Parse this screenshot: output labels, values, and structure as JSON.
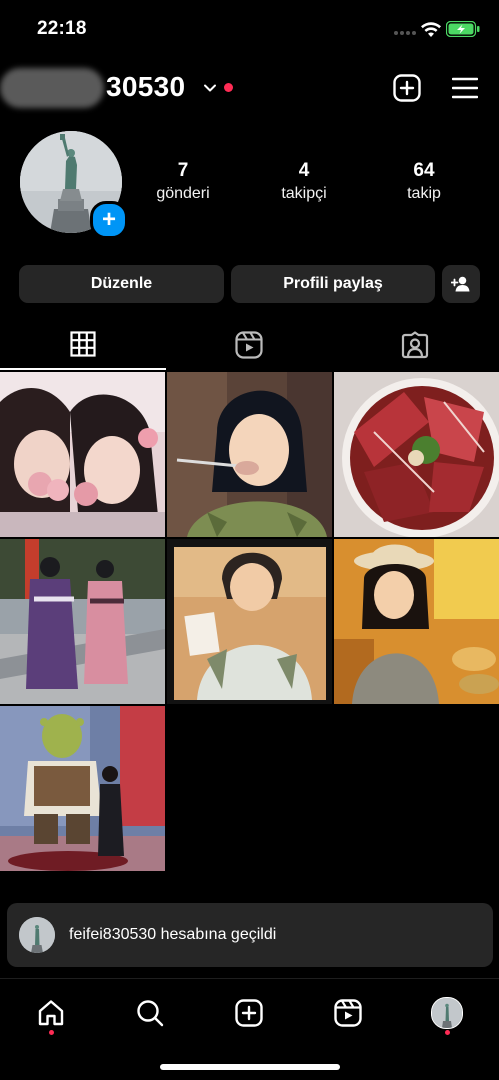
{
  "status_bar": {
    "time": "22:18",
    "wifi_icon": "wifi-icon",
    "battery_icon": "battery-charging-icon",
    "battery_color": "#4cd964"
  },
  "header": {
    "username": "30530",
    "chevron_icon": "chevron-down-icon",
    "notification_color": "#ff2c55",
    "create_icon": "plus-square-icon",
    "menu_icon": "hamburger-menu-icon"
  },
  "profile": {
    "avatar_icon": "statue-of-liberty-photo",
    "add_story_icon": "plus-icon",
    "add_story_symbol": "+",
    "stats": [
      {
        "value": "7",
        "label": "gönderi"
      },
      {
        "value": "4",
        "label": "takipçi"
      },
      {
        "value": "64",
        "label": "takip"
      }
    ]
  },
  "actions": {
    "edit_label": "Düzenle",
    "share_label": "Profili paylaş",
    "add_user_icon": "add-person-icon"
  },
  "tabs": [
    {
      "icon": "grid-icon",
      "active": true
    },
    {
      "icon": "reels-icon",
      "active": false
    },
    {
      "icon": "tagged-icon",
      "active": false
    }
  ],
  "grid": {
    "posts": [
      {
        "icon": "photo-two-girls-flowers"
      },
      {
        "icon": "photo-girl-eating"
      },
      {
        "icon": "photo-grilled-meat"
      },
      {
        "icon": "photo-kimono-street"
      },
      {
        "icon": "photo-boy-reading"
      },
      {
        "icon": "photo-girl-hat"
      },
      {
        "icon": "photo-shrek-statue"
      }
    ]
  },
  "toast": {
    "message": "feifei830530 hesabına geçildi"
  },
  "bottom_nav": {
    "items": [
      {
        "icon": "home-icon",
        "has_dot": true
      },
      {
        "icon": "search-icon",
        "has_dot": false
      },
      {
        "icon": "create-icon",
        "has_dot": false
      },
      {
        "icon": "reels-icon",
        "has_dot": false
      },
      {
        "icon": "profile-avatar-icon",
        "has_dot": true
      }
    ],
    "accent_color": "#ff2c55"
  },
  "colors": {
    "background": "#000000",
    "button_bg": "#262626",
    "primary_blue": "#0095f6"
  }
}
